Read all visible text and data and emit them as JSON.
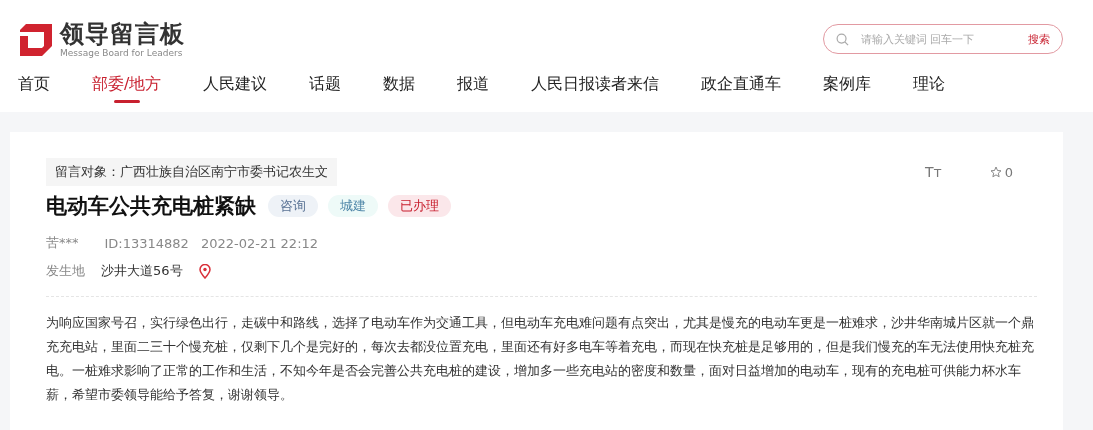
{
  "logo": {
    "title": "领导留言板",
    "subtitle": "Message Board for Leaders"
  },
  "search": {
    "placeholder": "请输入关键词 回车一下",
    "button": "搜索"
  },
  "nav": [
    {
      "label": "首页",
      "selected": false
    },
    {
      "label": "部委/地方",
      "selected": true
    },
    {
      "label": "人民建议",
      "selected": false
    },
    {
      "label": "话题",
      "selected": false
    },
    {
      "label": "数据",
      "selected": false
    },
    {
      "label": "报道",
      "selected": false
    },
    {
      "label": "人民日报读者来信",
      "selected": false
    },
    {
      "label": "政企直通车",
      "selected": false
    },
    {
      "label": "案例库",
      "selected": false
    },
    {
      "label": "理论",
      "selected": false
    }
  ],
  "message": {
    "recipient": "留言对象：广西壮族自治区南宁市委书记农生文",
    "font_size_button": "Tт",
    "favorites": "0",
    "title": "电动车公共充电桩紧缺",
    "tags": [
      {
        "label": "咨询",
        "kind": "type"
      },
      {
        "label": "城建",
        "kind": "field"
      },
      {
        "label": "已办理",
        "kind": "status"
      }
    ],
    "author": "苦***",
    "id": "ID:13314882",
    "time": "2022-02-21 22:12",
    "location_label": "发生地",
    "location": "沙井大道56号",
    "body": "为响应国家号召，实行绿色出行，走碳中和路线，选择了电动车作为交通工具，但电动车充电难问题有点突出，尤其是慢充的电动车更是一桩难求，沙井华南城片区就一个鼎充充电站，里面二三十个慢充桩，仅剩下几个是完好的，每次去都没位置充电，里面还有好多电车等着充电，而现在快充桩是足够用的，但是我们慢充的车无法使用快充桩充电。一桩难求影响了正常的工作和生活，不知今年是否会完善公共充电桩的建设，增加多一些充电站的密度和数量，面对日益增加的电动车，现有的充电桩可供能力杯水车薪，希望市委领导能给予答复，谢谢领导。"
  }
}
